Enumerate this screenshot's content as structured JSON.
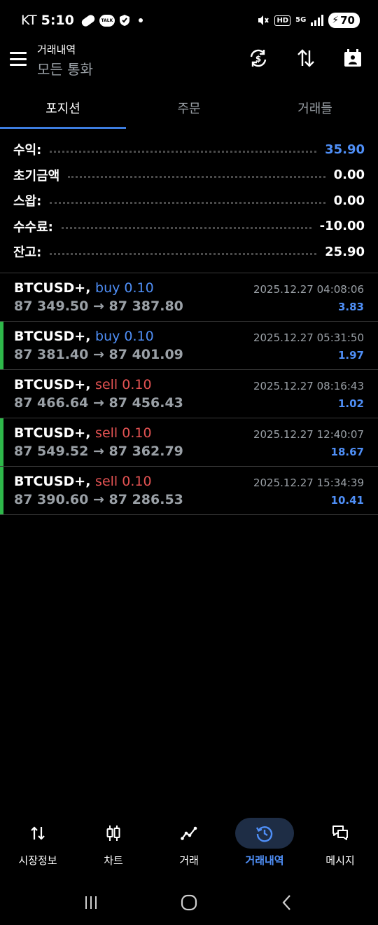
{
  "status_bar": {
    "carrier": "KT",
    "time": "5:10",
    "talk": "TALK",
    "hd": "HD",
    "net": "5G",
    "battery": "70"
  },
  "header": {
    "title": "거래내역",
    "subtitle": "모든 통화"
  },
  "tabs": [
    {
      "label": "포지션",
      "active": true
    },
    {
      "label": "주문",
      "active": false
    },
    {
      "label": "거래들",
      "active": false
    }
  ],
  "summary": [
    {
      "label": "수익:",
      "value": "35.90"
    },
    {
      "label": "초기금액",
      "value": "0.00"
    },
    {
      "label": "스왑:",
      "value": "0.00"
    },
    {
      "label": "수수료:",
      "value": "-10.00"
    },
    {
      "label": "잔고:",
      "value": "25.90"
    }
  ],
  "deals": [
    {
      "symbol": "BTCUSD+,",
      "type": "buy 0.10",
      "prices": "87 349.50 → 87 387.80",
      "time": "2025.12.27 04:08:06",
      "profit": "3.83"
    },
    {
      "symbol": "BTCUSD+,",
      "type": "buy 0.10",
      "prices": "87 381.40 → 87 401.09",
      "time": "2025.12.27 05:31:50",
      "profit": "1.97"
    },
    {
      "symbol": "BTCUSD+,",
      "type": "sell 0.10",
      "prices": "87 466.64 → 87 456.43",
      "time": "2025.12.27 08:16:43",
      "profit": "1.02"
    },
    {
      "symbol": "BTCUSD+,",
      "type": "sell 0.10",
      "prices": "87 549.52 → 87 362.79",
      "time": "2025.12.27 12:40:07",
      "profit": "18.67"
    },
    {
      "symbol": "BTCUSD+,",
      "type": "sell 0.10",
      "prices": "87 390.60 → 87 286.53",
      "time": "2025.12.27 15:34:39",
      "profit": "10.41"
    }
  ],
  "bottom_nav": [
    {
      "label": "시장정보",
      "icon": "quotes-arrows-icon"
    },
    {
      "label": "차트",
      "icon": "candlestick-icon"
    },
    {
      "label": "거래",
      "icon": "trade-line-icon"
    },
    {
      "label": "거래내역",
      "icon": "history-icon",
      "active": true
    },
    {
      "label": "메시지",
      "icon": "chat-icon"
    }
  ],
  "colors": {
    "accent": "#4f8ff7",
    "sell": "#e55353",
    "marker": "#2eb84a",
    "tab_underline": "#3d7de0"
  }
}
